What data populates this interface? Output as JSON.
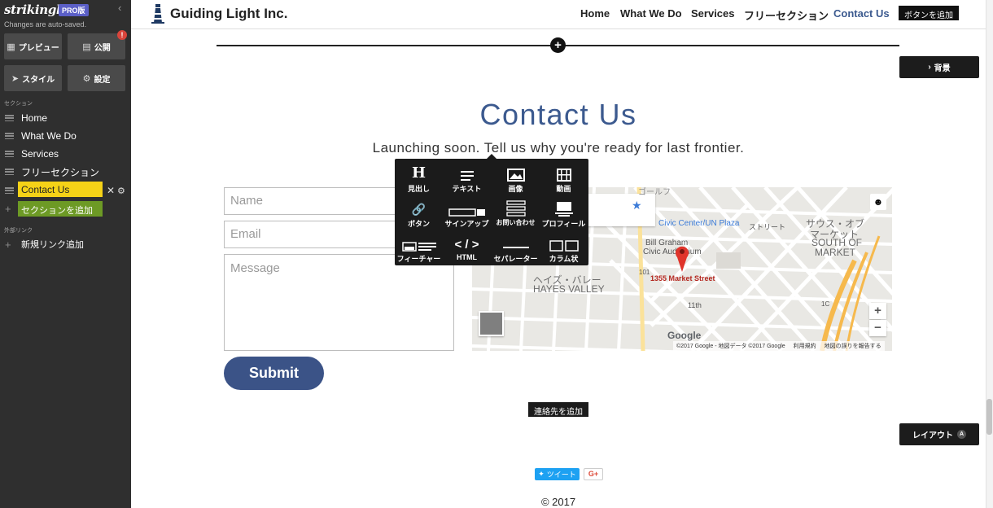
{
  "sidebar": {
    "brand": "strikingly",
    "pro_badge": "PRO版",
    "autosave": "Changes are auto-saved.",
    "buttons": {
      "preview": "プレビュー",
      "publish": "公開",
      "style": "スタイル",
      "settings": "設定"
    },
    "publish_alert": "!",
    "sections_heading": "セクション",
    "sections": [
      {
        "label": "Home"
      },
      {
        "label": "What We Do"
      },
      {
        "label": "Services"
      },
      {
        "label": "フリーセクション"
      },
      {
        "label": "Contact Us"
      }
    ],
    "add_section": "セクションを追加",
    "external_links_heading": "外部リンク",
    "add_link": "新規リンク追加"
  },
  "header": {
    "site_title": "Guiding Light Inc.",
    "nav": [
      "Home",
      "What We Do",
      "Services",
      "フリーセクション",
      "Contact Us"
    ],
    "active_nav": "Contact Us",
    "add_button": "ボタンを追加"
  },
  "editor": {
    "background_button": "背景",
    "layout_button": "レイアウト",
    "layout_badge": "A",
    "add_contact": "連絡先を追加"
  },
  "section": {
    "title": "Contact Us",
    "subtitle": "Launching soon. Tell us why you're ready for last frontier."
  },
  "form": {
    "name_placeholder": "Name",
    "email_placeholder": "Email",
    "message_placeholder": "Message",
    "submit": "Submit"
  },
  "picker": [
    {
      "label": "見出し",
      "icon": "heading-icon"
    },
    {
      "label": "テキスト",
      "icon": "text-icon"
    },
    {
      "label": "画像",
      "icon": "image-icon"
    },
    {
      "label": "動画",
      "icon": "video-icon"
    },
    {
      "label": "ボタン",
      "icon": "link-icon"
    },
    {
      "label": "サインアップ",
      "icon": "signup-icon"
    },
    {
      "label": "お問い合わせ",
      "icon": "contact-form-icon"
    },
    {
      "label": "プロフィール",
      "icon": "profile-icon"
    },
    {
      "label": "フィーチャー",
      "icon": "feature-icon"
    },
    {
      "label": "HTML",
      "icon": "html-icon"
    },
    {
      "label": "セパレーター",
      "icon": "separator-icon"
    },
    {
      "label": "カラム状",
      "icon": "columns-icon"
    }
  ],
  "map": {
    "labels": {
      "civic_center": "Civic Center/UN Plaza",
      "bill_graham": "Bill Graham",
      "civic_auditorium": "Civic Auditorium",
      "south_market_jp_1": "サウス・オブ",
      "south_market_jp_2": "マーケット",
      "south_market_en_1": "SOUTH OF",
      "south_market_en_2": "MARKET",
      "hayes_valley_jp": "ヘイズ・バレー",
      "hayes_valley_en": "HAYES VALLEY",
      "gough_jp": "ゴールフ",
      "market_street": "1355 Market Street",
      "route_101": "101",
      "route_1c": "1C",
      "eleventh": "11th",
      "street_jp": "ストリート"
    },
    "google": "Google",
    "footer": [
      "©2017 Google - 地図データ ©2017 Google",
      "利用規約",
      "地図の誤りを報告する"
    ],
    "zoom_in": "+",
    "zoom_out": "−"
  },
  "social": {
    "tweet": "ツイート",
    "gplus": "G+"
  },
  "footer": {
    "copyright": "© 2017"
  },
  "colors": {
    "accent": "#3c5a8f",
    "sidebar_bg": "#2f2f2f",
    "active_section": "#f5d217",
    "add_section": "#6d9a25",
    "submit": "#3b5387"
  }
}
